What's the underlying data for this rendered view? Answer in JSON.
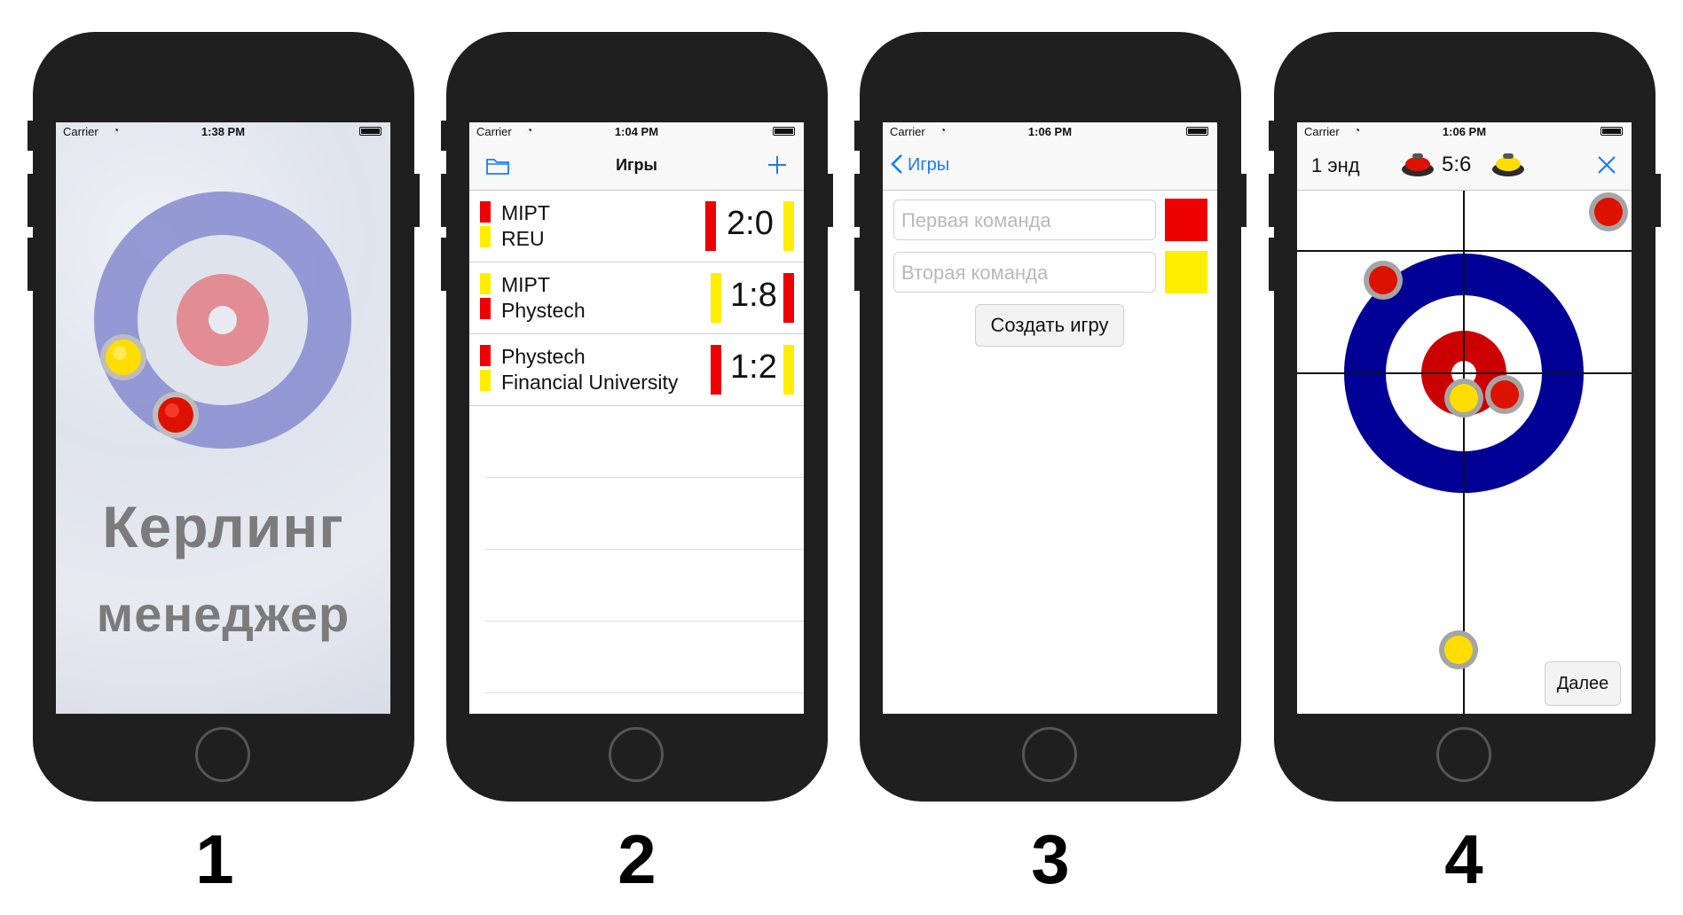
{
  "colors": {
    "red": "#ee0000",
    "yellow": "#ffee00",
    "ice_blue": "#8b8fd0",
    "ice_pink": "#e28d93",
    "house_blue": "#000096",
    "house_red": "#cc0000",
    "ios_blue": "#1a7cf3"
  },
  "screens": [
    {
      "number": "1",
      "status": {
        "carrier": "Carrier",
        "time": "1:38 PM"
      },
      "logo_line1": "Керлинг",
      "logo_line2": "менеджер"
    },
    {
      "number": "2",
      "status": {
        "carrier": "Carrier",
        "time": "1:04 PM"
      },
      "nav": {
        "title": "Игры",
        "left_icon": "folder-icon",
        "right_icon": "plus-icon"
      },
      "games": [
        {
          "team1": "MIPT",
          "team2": "REU",
          "score": "2:0"
        },
        {
          "team1": "MIPT",
          "team2": "Phystech",
          "score": "1:8"
        },
        {
          "team1": "Phystech",
          "team2": "Financial University",
          "score": "1:2"
        }
      ]
    },
    {
      "number": "3",
      "status": {
        "carrier": "Carrier",
        "time": "1:06 PM"
      },
      "nav": {
        "back_label": "Игры"
      },
      "form": {
        "team1_placeholder": "Первая команда",
        "team2_placeholder": "Вторая команда",
        "create_button": "Создать игру"
      }
    },
    {
      "number": "4",
      "status": {
        "carrier": "Carrier",
        "time": "1:06 PM"
      },
      "nav": {
        "end_label": "1 энд",
        "score": "5:6",
        "close_icon": "close-icon"
      },
      "next_button": "Далее"
    }
  ]
}
